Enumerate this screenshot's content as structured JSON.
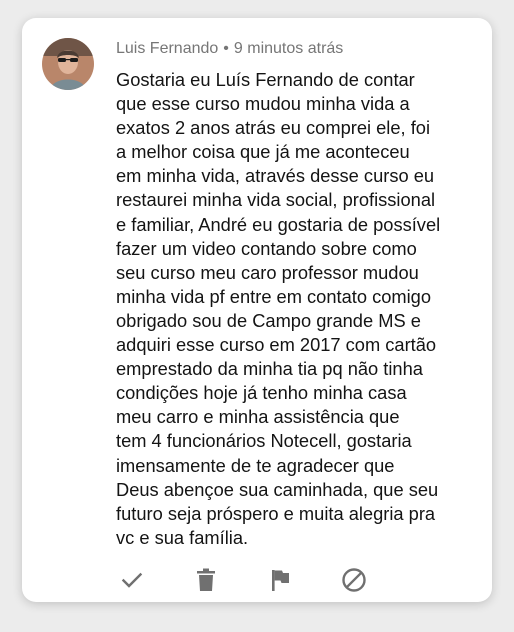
{
  "comment": {
    "author": "Luis Fernando",
    "separator": "•",
    "time": "9 minutos atrás",
    "text": "Gostaria eu Luís Fernando de contar\nque esse curso mudou minha vida a\nexatos 2 anos atrás eu comprei ele, foi\na melhor coisa que já me aconteceu\nem minha vida, através desse curso eu\nrestaurei minha vida social, profissional\ne familiar, André eu gostaria de possível\nfazer um video contando sobre como\nseu curso meu caro professor mudou\nminha vida pf entre em contato comigo\nobrigado sou de Campo grande MS e\nadquiri esse curso em 2017 com cartão\nemprestado da minha tia pq não tinha\ncondições hoje já tenho minha casa\nmeu carro e minha assistência que\ntem 4 funcionários Notecell, gostaria\nimensamente de te agradecer que\nDeus abençoe sua caminhada, que seu\nfuturo seja próspero e muita alegria pra\nvc e sua família."
  },
  "actions": [
    {
      "icon": "check-icon",
      "name": "approve"
    },
    {
      "icon": "trash-icon",
      "name": "delete"
    },
    {
      "icon": "flag-icon",
      "name": "report"
    },
    {
      "icon": "block-icon",
      "name": "block"
    }
  ],
  "colors": {
    "meta_text": "#767676",
    "body_text": "#141414",
    "icon": "#707070",
    "card": "#ffffff",
    "background": "#ececec"
  }
}
